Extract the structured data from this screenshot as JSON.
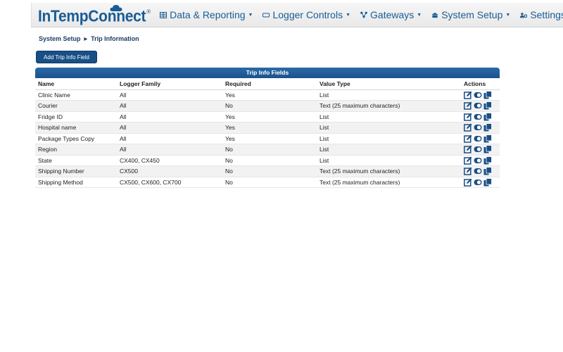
{
  "brand": {
    "name": "InTempConnect",
    "reg": "®"
  },
  "nav": {
    "items": [
      {
        "label": "Data & Reporting",
        "icon": "table-icon"
      },
      {
        "label": "Logger Controls",
        "icon": "device-icon"
      },
      {
        "label": "Gateways",
        "icon": "network-icon"
      },
      {
        "label": "System Setup",
        "icon": "building-icon"
      },
      {
        "label": "Settings",
        "icon": "users-settings-icon"
      }
    ]
  },
  "breadcrumb": {
    "parent": "System Setup",
    "current": "Trip Information"
  },
  "add_button": {
    "label": "Add Trip Info Field"
  },
  "panel": {
    "title": "Trip Info Fields"
  },
  "table": {
    "headers": {
      "name": "Name",
      "family": "Logger Family",
      "required": "Required",
      "type": "Value Type",
      "actions": "Actions"
    },
    "rows": [
      {
        "name": "Clinic Name",
        "family": "All",
        "required": "Yes",
        "type": "List"
      },
      {
        "name": "Courier",
        "family": "All",
        "required": "No",
        "type": "Text (25 maximum characters)"
      },
      {
        "name": "Fridge ID",
        "family": "All",
        "required": "Yes",
        "type": "List"
      },
      {
        "name": "Hospital name",
        "family": "All",
        "required": "Yes",
        "type": "List"
      },
      {
        "name": "Package Types Copy",
        "family": "All",
        "required": "Yes",
        "type": "List"
      },
      {
        "name": "Region",
        "family": "All",
        "required": "No",
        "type": "List"
      },
      {
        "name": "State",
        "family": "CX400, CX450",
        "required": "No",
        "type": "List"
      },
      {
        "name": "Shipping Number",
        "family": "CX500",
        "required": "No",
        "type": "Text (25 maximum characters)"
      },
      {
        "name": "Shipping Method",
        "family": "CX500, CX600, CX700",
        "required": "No",
        "type": "Text (25 maximum characters)"
      }
    ]
  },
  "colors": {
    "brand": "#1a5c96",
    "header": "#1a528b",
    "button": "#184f86"
  }
}
